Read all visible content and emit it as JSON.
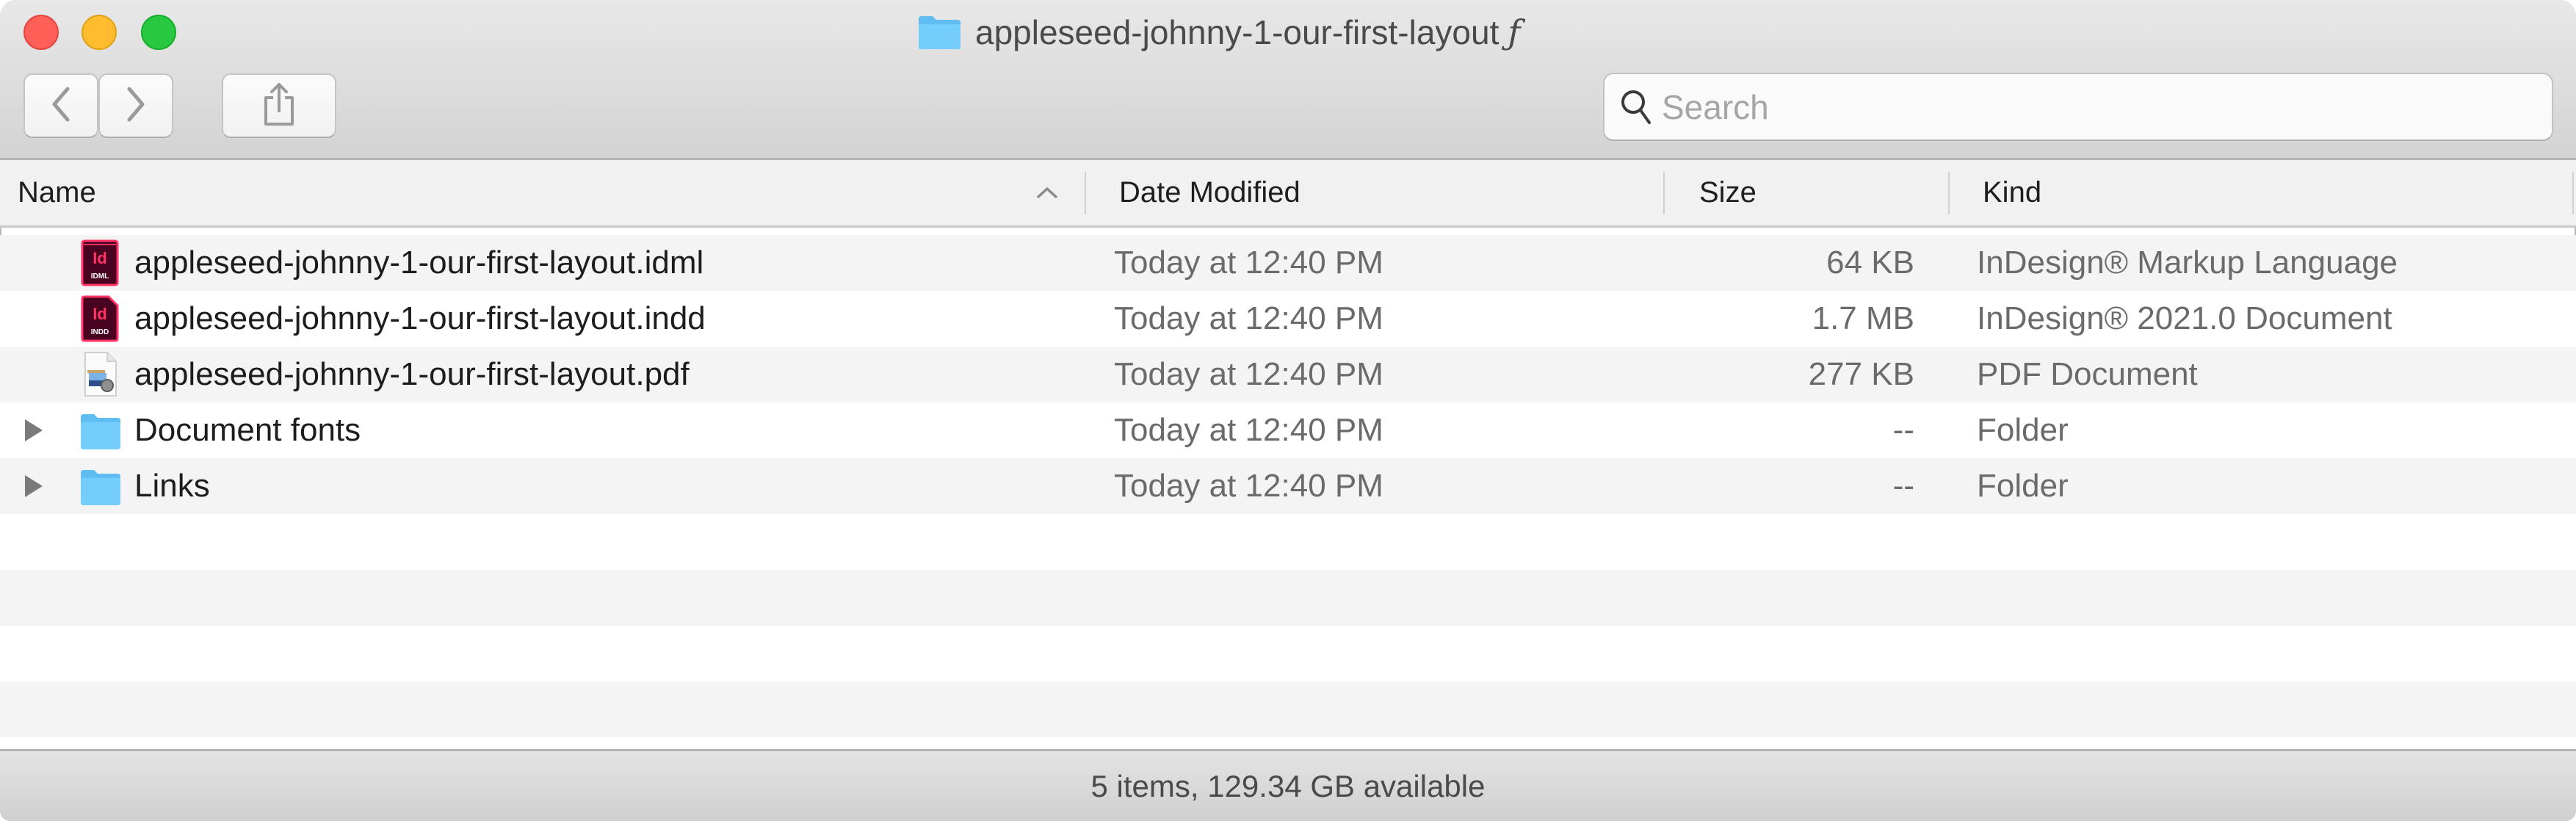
{
  "window": {
    "title": "appleseed-johnny-1-our-first-layout",
    "title_suffix": "ƒ",
    "title_icon": "folder-icon"
  },
  "toolbar": {
    "back_icon": "chevron-left-icon",
    "forward_icon": "chevron-right-icon",
    "share_icon": "share-icon",
    "search": {
      "value": "",
      "placeholder": "Search",
      "icon": "search-icon"
    }
  },
  "columns": {
    "name": "Name",
    "date": "Date Modified",
    "size": "Size",
    "kind": "Kind",
    "sort_column": "Name",
    "sort_direction": "ascending"
  },
  "files": [
    {
      "name": "appleseed-johnny-1-our-first-layout.idml",
      "date": "Today at 12:40 PM",
      "size": "64 KB",
      "kind": "InDesign® Markup Language",
      "icon": "indesign-idml-icon",
      "icon_label": "IDML",
      "expandable": false
    },
    {
      "name": "appleseed-johnny-1-our-first-layout.indd",
      "date": "Today at 12:40 PM",
      "size": "1.7 MB",
      "kind": "InDesign® 2021.0 Document",
      "icon": "indesign-indd-icon",
      "icon_label": "INDD",
      "expandable": false
    },
    {
      "name": "appleseed-johnny-1-our-first-layout.pdf",
      "date": "Today at 12:40 PM",
      "size": "277 KB",
      "kind": "PDF Document",
      "icon": "pdf-document-icon",
      "expandable": false
    },
    {
      "name": "Document fonts",
      "date": "Today at 12:40 PM",
      "size": "--",
      "kind": "Folder",
      "icon": "folder-icon",
      "expandable": true
    },
    {
      "name": "Links",
      "date": "Today at 12:40 PM",
      "size": "--",
      "kind": "Folder",
      "icon": "folder-icon",
      "expandable": true
    }
  ],
  "status": {
    "text": "5 items, 129.34 GB available"
  },
  "colors": {
    "indesign_bg": "#49021f",
    "indesign_accent": "#ff3366",
    "folder_blue": "#6ccaf8"
  }
}
